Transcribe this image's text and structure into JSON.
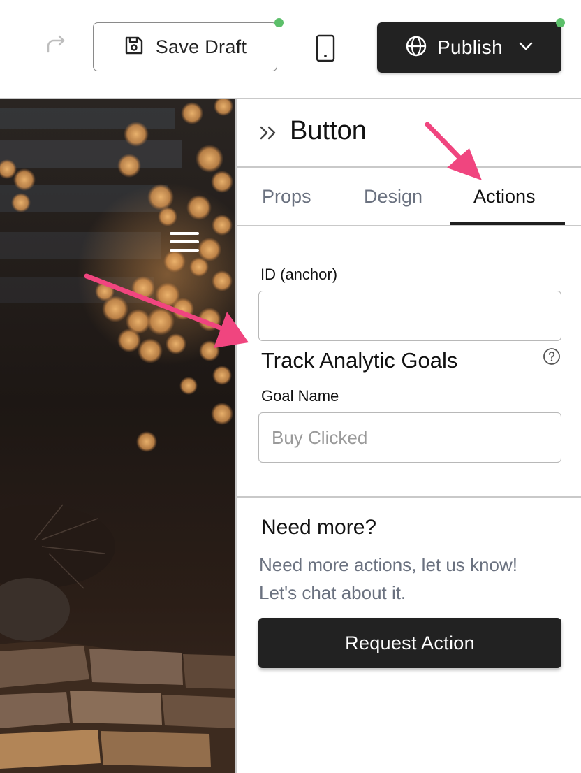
{
  "toolbar": {
    "save_draft_label": "Save Draft",
    "publish_label": "Publish",
    "icons": [
      "undo-icon",
      "redo-icon",
      "save-icon",
      "mobile-device-icon",
      "globe-icon",
      "chevron-down-icon"
    ],
    "status_dot_color": "#5cbf6a"
  },
  "panel": {
    "title": "Button",
    "tabs": [
      {
        "label": "Props",
        "active": false
      },
      {
        "label": "Design",
        "active": false
      },
      {
        "label": "Actions",
        "active": true
      }
    ],
    "id_anchor": {
      "label": "ID (anchor)",
      "value": "",
      "placeholder": ""
    },
    "analytics": {
      "title": "Track Analytic Goals",
      "goal_name_label": "Goal Name",
      "goal_name_placeholder": "Buy Clicked",
      "goal_name_value": ""
    },
    "need_more": {
      "title": "Need more?",
      "line1": "Need more actions, let us know!",
      "line2": "Let's chat about it.",
      "button_label": "Request Action"
    }
  },
  "colors": {
    "dark_button": "#222222",
    "accent_arrow": "#f0457f",
    "tab_inactive": "#6b7280"
  }
}
